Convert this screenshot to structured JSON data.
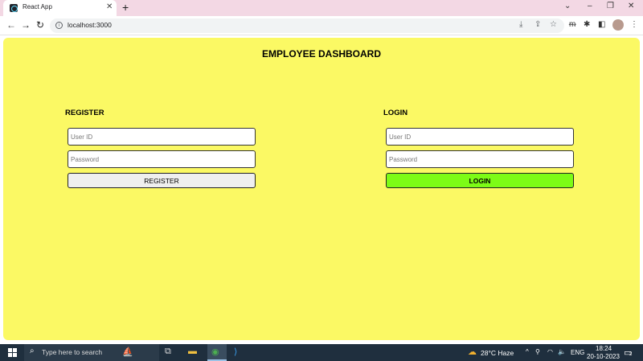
{
  "browser": {
    "tab_title": "React App",
    "close_tab": "✕",
    "new_tab": "+",
    "url": "localhost:3000",
    "window_controls": [
      "⌄",
      "–",
      "❐",
      "✕"
    ]
  },
  "page": {
    "title": "EMPLOYEE DASHBOARD",
    "register": {
      "heading": "REGISTER",
      "userid_placeholder": "User ID",
      "password_placeholder": "Password",
      "button_label": "REGISTER",
      "button_color": "#efefef"
    },
    "login": {
      "heading": "LOGIN",
      "userid_placeholder": "User ID",
      "password_placeholder": "Password",
      "button_label": "LOGIN",
      "button_color": "#7dfc16"
    },
    "background_color": "#fbf964"
  },
  "taskbar": {
    "search_placeholder": "Type here to search",
    "weather": "28°C  Haze",
    "language": "ENG",
    "time": "18:24",
    "date": "20-10-2023",
    "notification_count": "2"
  }
}
